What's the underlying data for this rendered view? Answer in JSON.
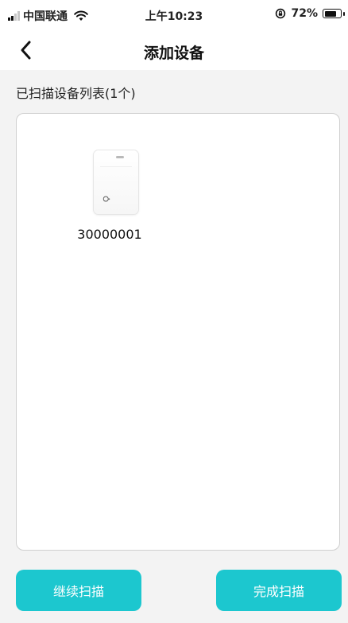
{
  "status_bar": {
    "carrier": "中国联通",
    "time": "上午10:23",
    "battery_percent": "72%",
    "signal_bars_filled": 2,
    "signal_bars_total": 4,
    "battery_level": 0.72,
    "icons": [
      "signal-icon",
      "wifi-icon",
      "orientation-lock-icon",
      "battery-icon"
    ]
  },
  "nav": {
    "title": "添加设备",
    "back_icon": "chevron-left-icon"
  },
  "device_list": {
    "heading": "已扫描设备列表(1个)",
    "devices": [
      {
        "id": "30000001",
        "icon": "device-image"
      }
    ]
  },
  "actions": {
    "continue_label": "继续扫描",
    "finish_label": "完成扫描"
  },
  "colors": {
    "accent": "#1cc7cf",
    "page_background": "#f3f3f3",
    "panel_border": "#cfcfcf"
  }
}
